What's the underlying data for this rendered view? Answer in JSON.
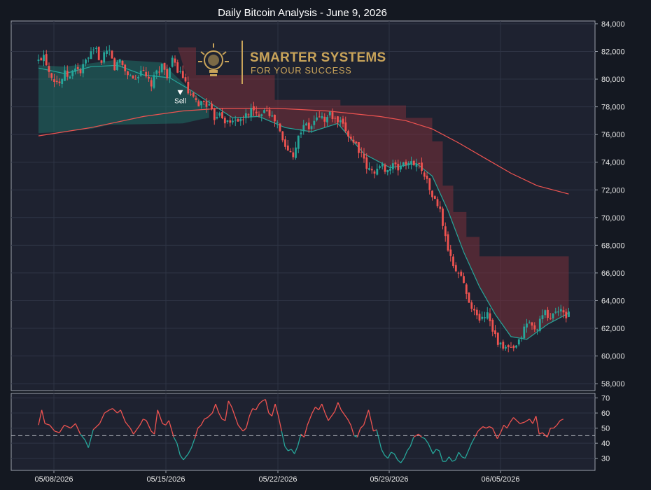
{
  "chart_data": [
    {
      "type": "candlestick",
      "title": "Daily Bitcoin Analysis - June 9, 2026",
      "y_ticks": [
        "84,000",
        "82,000",
        "80,000",
        "78,000",
        "76,000",
        "74,000",
        "72,000",
        "70,000",
        "68,000",
        "66,000",
        "64,000",
        "62,000",
        "60,000",
        "58,000"
      ],
      "ylim": [
        57500,
        84200
      ],
      "x_ticks": [
        "05/08/2026",
        "05/15/2026",
        "05/22/2026",
        "05/29/2026",
        "06/05/2026"
      ],
      "grid": true,
      "colors": {
        "up": "#26a69a",
        "down": "#ef5350",
        "ema_fast": "#26a69a",
        "ema_slow": "#ef5350",
        "bull_cloud": "#1f6e66",
        "bear_cloud": "#7a2f3a"
      },
      "price_path": [
        [
          0,
          81300
        ],
        [
          2,
          81800
        ],
        [
          4,
          80600
        ],
        [
          6,
          80000
        ],
        [
          8,
          79700
        ],
        [
          10,
          80400
        ],
        [
          12,
          80100
        ],
        [
          14,
          80900
        ],
        [
          16,
          80500
        ],
        [
          18,
          81300
        ],
        [
          20,
          81800
        ],
        [
          22,
          82100
        ],
        [
          24,
          81100
        ],
        [
          25,
          81700
        ],
        [
          27,
          82000
        ],
        [
          29,
          80800
        ],
        [
          31,
          81400
        ],
        [
          33,
          80600
        ],
        [
          35,
          80200
        ],
        [
          37,
          80000
        ],
        [
          39,
          80700
        ],
        [
          41,
          80100
        ],
        [
          43,
          79600
        ],
        [
          45,
          80500
        ],
        [
          47,
          81000
        ],
        [
          49,
          80300
        ],
        [
          51,
          81300
        ],
        [
          53,
          80700
        ],
        [
          55,
          80200
        ],
        [
          57,
          79000
        ],
        [
          59,
          78500
        ],
        [
          61,
          78200
        ],
        [
          63,
          78400
        ],
        [
          65,
          78000
        ],
        [
          67,
          77200
        ],
        [
          69,
          77700
        ],
        [
          71,
          77000
        ],
        [
          73,
          76800
        ],
        [
          75,
          77200
        ],
        [
          77,
          76900
        ],
        [
          79,
          77400
        ],
        [
          81,
          77800
        ],
        [
          83,
          77400
        ],
        [
          85,
          77700
        ],
        [
          87,
          77900
        ],
        [
          89,
          77200
        ],
        [
          91,
          76800
        ],
        [
          93,
          75500
        ],
        [
          95,
          74800
        ],
        [
          97,
          74600
        ],
        [
          99,
          75800
        ],
        [
          101,
          76800
        ],
        [
          103,
          76400
        ],
        [
          105,
          76900
        ],
        [
          107,
          77400
        ],
        [
          109,
          77000
        ],
        [
          111,
          77500
        ],
        [
          113,
          77000
        ],
        [
          115,
          76800
        ],
        [
          117,
          76300
        ],
        [
          119,
          75700
        ],
        [
          121,
          75300
        ],
        [
          123,
          74500
        ],
        [
          125,
          73600
        ],
        [
          127,
          73300
        ],
        [
          129,
          73500
        ],
        [
          131,
          73700
        ],
        [
          133,
          73400
        ],
        [
          135,
          73800
        ],
        [
          137,
          73500
        ],
        [
          139,
          74000
        ],
        [
          141,
          73800
        ],
        [
          143,
          74000
        ],
        [
          145,
          73800
        ],
        [
          147,
          73200
        ],
        [
          149,
          72000
        ],
        [
          151,
          71200
        ],
        [
          153,
          70500
        ],
        [
          155,
          68500
        ],
        [
          157,
          67000
        ],
        [
          159,
          66200
        ],
        [
          161,
          65800
        ],
        [
          163,
          64500
        ],
        [
          165,
          63600
        ],
        [
          167,
          62800
        ],
        [
          169,
          62700
        ],
        [
          171,
          63200
        ],
        [
          173,
          62000
        ],
        [
          175,
          61000
        ],
        [
          177,
          60500
        ],
        [
          179,
          60600
        ],
        [
          181,
          60400
        ],
        [
          183,
          61000
        ],
        [
          185,
          62000
        ],
        [
          187,
          62500
        ],
        [
          189,
          61800
        ],
        [
          191,
          62500
        ],
        [
          193,
          63100
        ],
        [
          195,
          62700
        ],
        [
          197,
          63300
        ],
        [
          199,
          63200
        ],
        [
          201,
          62800
        ],
        [
          202,
          63300
        ]
      ],
      "ema_fast_path": [
        [
          0,
          80800
        ],
        [
          10,
          80400
        ],
        [
          20,
          80900
        ],
        [
          30,
          81000
        ],
        [
          40,
          80300
        ],
        [
          50,
          80100
        ],
        [
          58,
          79200
        ],
        [
          66,
          78200
        ],
        [
          74,
          77200
        ],
        [
          84,
          77300
        ],
        [
          94,
          76500
        ],
        [
          104,
          76200
        ],
        [
          114,
          76800
        ],
        [
          124,
          74600
        ],
        [
          134,
          73600
        ],
        [
          144,
          73900
        ],
        [
          150,
          73000
        ],
        [
          156,
          70500
        ],
        [
          162,
          67500
        ],
        [
          168,
          65000
        ],
        [
          174,
          63000
        ],
        [
          180,
          61400
        ],
        [
          186,
          61200
        ],
        [
          194,
          62300
        ],
        [
          202,
          63100
        ]
      ],
      "ema_slow_path": [
        [
          0,
          75900
        ],
        [
          20,
          76500
        ],
        [
          40,
          77300
        ],
        [
          55,
          77700
        ],
        [
          70,
          77900
        ],
        [
          90,
          77900
        ],
        [
          110,
          77700
        ],
        [
          130,
          77300
        ],
        [
          140,
          77000
        ],
        [
          150,
          76400
        ],
        [
          160,
          75400
        ],
        [
          170,
          74300
        ],
        [
          180,
          73200
        ],
        [
          190,
          72300
        ],
        [
          202,
          71700
        ]
      ],
      "bull_cloud_path": [
        [
          0,
          76100
        ],
        [
          10,
          76200
        ],
        [
          20,
          76400
        ],
        [
          27,
          76700
        ],
        [
          55,
          76800
        ],
        [
          62,
          77100
        ],
        [
          65,
          77200
        ]
      ],
      "bear_cloud_upper": [
        [
          53,
          82300
        ],
        [
          60,
          82300
        ],
        [
          60,
          80300
        ],
        [
          90,
          80300
        ],
        [
          90,
          78500
        ],
        [
          115,
          78500
        ],
        [
          115,
          78100
        ],
        [
          140,
          78100
        ],
        [
          140,
          77200
        ],
        [
          150,
          77200
        ],
        [
          150,
          75500
        ],
        [
          154,
          75500
        ],
        [
          154,
          72300
        ],
        [
          158,
          72300
        ],
        [
          158,
          70400
        ],
        [
          163,
          70400
        ],
        [
          163,
          68600
        ],
        [
          168,
          68600
        ],
        [
          168,
          67200
        ],
        [
          202,
          67200
        ],
        [
          202,
          64200
        ]
      ],
      "markers": [
        {
          "label": "Sell",
          "x_index": 54,
          "price": 78600
        }
      ]
    },
    {
      "type": "line",
      "name": "oscillator",
      "y_ticks": [
        "70",
        "60",
        "50",
        "40",
        "30"
      ],
      "ylim": [
        22,
        73
      ],
      "reference_level": 45,
      "grid": true,
      "path": [
        [
          0,
          52
        ],
        [
          2,
          62
        ],
        [
          4,
          53
        ],
        [
          7,
          52
        ],
        [
          10,
          48
        ],
        [
          13,
          47
        ],
        [
          16,
          52
        ],
        [
          20,
          50
        ],
        [
          23,
          53
        ],
        [
          26,
          46
        ],
        [
          29,
          42
        ],
        [
          31,
          37
        ],
        [
          34,
          49
        ],
        [
          38,
          53
        ],
        [
          41,
          60
        ],
        [
          44,
          62
        ],
        [
          46,
          63
        ],
        [
          49,
          60
        ],
        [
          51,
          62
        ],
        [
          54,
          54
        ],
        [
          57,
          50
        ],
        [
          59,
          46
        ],
        [
          61,
          49
        ],
        [
          63,
          52
        ],
        [
          65,
          56
        ],
        [
          67,
          55
        ],
        [
          70,
          48
        ],
        [
          72,
          46
        ],
        [
          74,
          62
        ],
        [
          77,
          53
        ],
        [
          79,
          52
        ],
        [
          81,
          55
        ],
        [
          84,
          44
        ],
        [
          86,
          40
        ],
        [
          88,
          32
        ],
        [
          90,
          29
        ],
        [
          93,
          33
        ],
        [
          95,
          37
        ],
        [
          97,
          43
        ],
        [
          99,
          50
        ],
        [
          101,
          52
        ],
        [
          103,
          56
        ],
        [
          105,
          57
        ],
        [
          108,
          60
        ],
        [
          110,
          66
        ],
        [
          112,
          60
        ],
        [
          114,
          56
        ],
        [
          116,
          55
        ],
        [
          118,
          68
        ],
        [
          120,
          64
        ],
        [
          122,
          58
        ],
        [
          124,
          52
        ],
        [
          127,
          48
        ],
        [
          129,
          50
        ],
        [
          131,
          58
        ],
        [
          133,
          63
        ],
        [
          135,
          62
        ],
        [
          137,
          66
        ],
        [
          139,
          68
        ],
        [
          141,
          69
        ],
        [
          143,
          60
        ],
        [
          145,
          58
        ],
        [
          147,
          66
        ],
        [
          149,
          58
        ],
        [
          151,
          48
        ],
        [
          153,
          38
        ],
        [
          155,
          35
        ],
        [
          157,
          36
        ],
        [
          159,
          33
        ],
        [
          161,
          38
        ],
        [
          163,
          46
        ],
        [
          165,
          44
        ],
        [
          167,
          52
        ],
        [
          170,
          60
        ],
        [
          172,
          64
        ],
        [
          174,
          62
        ],
        [
          176,
          66
        ],
        [
          178,
          60
        ],
        [
          180,
          55
        ],
        [
          182,
          58
        ],
        [
          184,
          61
        ],
        [
          186,
          67
        ],
        [
          188,
          62
        ],
        [
          190,
          59
        ],
        [
          192,
          56
        ],
        [
          194,
          52
        ],
        [
          196,
          45
        ],
        [
          198,
          44
        ],
        [
          200,
          50
        ],
        [
          202,
          52
        ],
        [
          205,
          62
        ],
        [
          208,
          48
        ],
        [
          210,
          49
        ],
        [
          213,
          36
        ],
        [
          215,
          32
        ],
        [
          217,
          30
        ],
        [
          219,
          34
        ],
        [
          221,
          33
        ],
        [
          223,
          29
        ],
        [
          225,
          27
        ],
        [
          227,
          30
        ],
        [
          229,
          35
        ],
        [
          231,
          38
        ],
        [
          233,
          44
        ],
        [
          236,
          46
        ],
        [
          238,
          44
        ],
        [
          240,
          43
        ],
        [
          242,
          40
        ],
        [
          245,
          33
        ],
        [
          247,
          36
        ],
        [
          249,
          35
        ],
        [
          251,
          28
        ],
        [
          253,
          28
        ],
        [
          255,
          31
        ],
        [
          257,
          28
        ],
        [
          259,
          29
        ],
        [
          261,
          34
        ],
        [
          263,
          31
        ],
        [
          265,
          30
        ],
        [
          267,
          35
        ],
        [
          269,
          40
        ],
        [
          271,
          44
        ],
        [
          273,
          48
        ],
        [
          276,
          51
        ],
        [
          278,
          50
        ],
        [
          280,
          51
        ],
        [
          282,
          50
        ],
        [
          285,
          43
        ],
        [
          287,
          47
        ],
        [
          289,
          52
        ],
        [
          291,
          50
        ],
        [
          293,
          54
        ],
        [
          295,
          57
        ],
        [
          297,
          55
        ],
        [
          299,
          53
        ],
        [
          302,
          54
        ],
        [
          305,
          56
        ],
        [
          307,
          53
        ],
        [
          309,
          58
        ],
        [
          311,
          46
        ],
        [
          313,
          47
        ],
        [
          316,
          44
        ],
        [
          318,
          50
        ],
        [
          320,
          50
        ],
        [
          322,
          52
        ],
        [
          324,
          55
        ],
        [
          326,
          56
        ]
      ]
    }
  ],
  "branding": {
    "line1": "SMARTER SYSTEMS",
    "line2": "FOR YOUR SUCCESS"
  },
  "theme": {
    "background": "#141821",
    "panel": "#1e2230",
    "grid": "#2f3445",
    "border": "#9aa0aa",
    "text": "#e6e6e6",
    "accent_gold": "#c9a45a"
  }
}
